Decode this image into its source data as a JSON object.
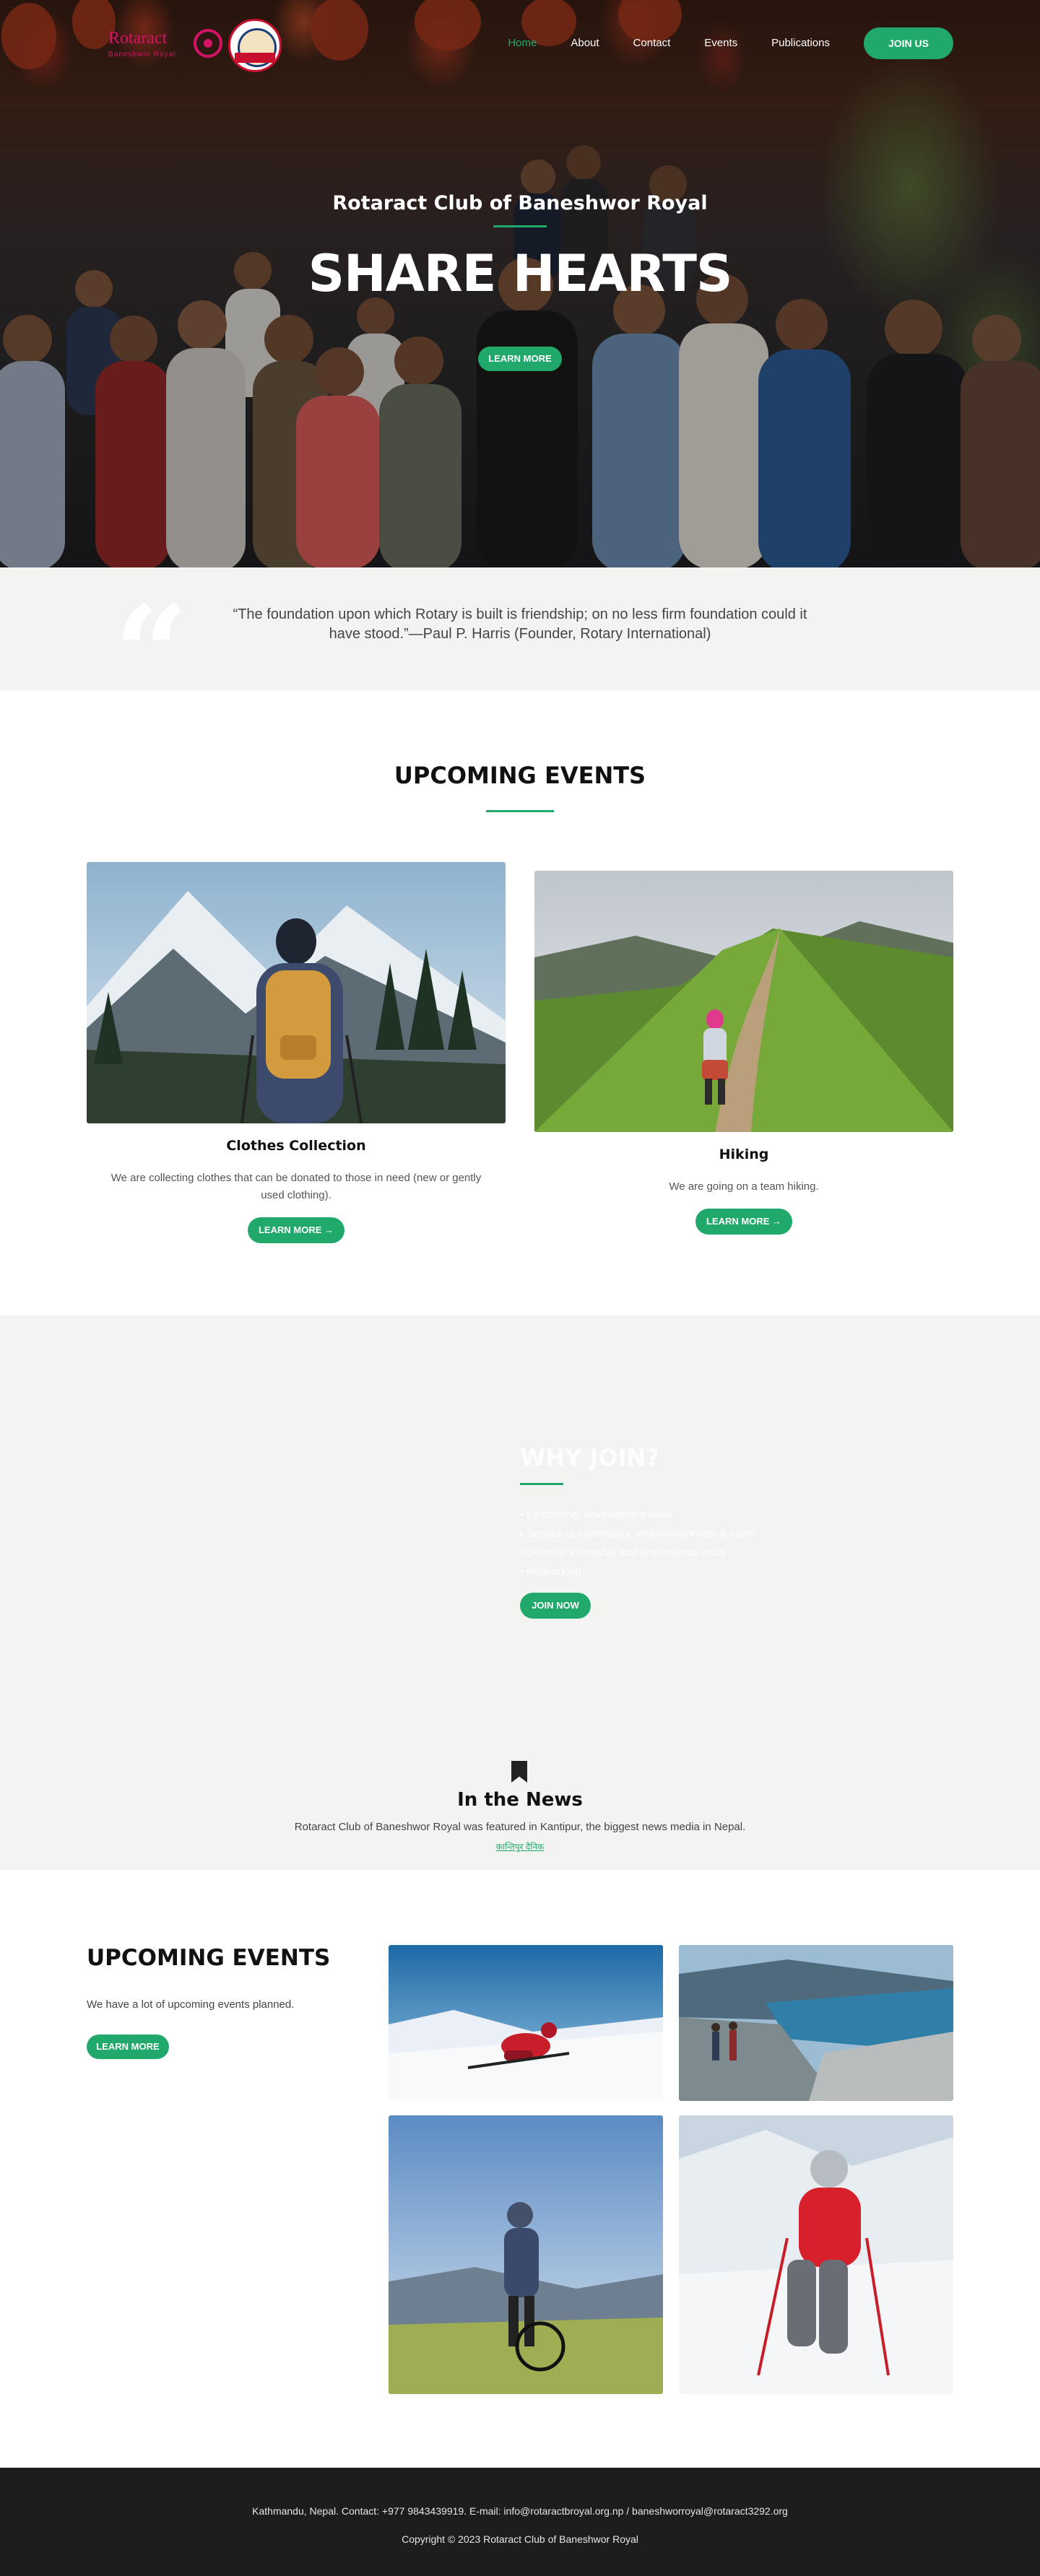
{
  "brand": {
    "logo_text": "Rotaract",
    "logo_sub": "Baneshwor Royal"
  },
  "nav": {
    "items": [
      {
        "label": "Home",
        "active": true
      },
      {
        "label": "About",
        "active": false
      },
      {
        "label": "Contact",
        "active": false
      },
      {
        "label": "Events",
        "active": false
      },
      {
        "label": "Publications",
        "active": false
      }
    ],
    "join_label": "JOIN US"
  },
  "hero": {
    "subtitle": "Rotaract Club of Baneshwor Royal",
    "title": "SHARE HEARTS",
    "button": "LEARN MORE"
  },
  "quote": {
    "icon": "quote-icon",
    "text": "“The foundation upon which Rotary is built is friendship; on no less firm foundation could it have stood.”—Paul P. Harris (Founder, Rotary International)"
  },
  "events": {
    "title": "UPCOMING EVENTS",
    "cards": [
      {
        "title": "Clothes Collection",
        "description": "We are collecting clothes that can be donated to those in need (new or gently used clothing).",
        "button": "LEARN MORE",
        "button_icon": "arrow-right-icon"
      },
      {
        "title": "Hiking",
        "description": "We are going on a team hiking.",
        "button": "LEARN MORE",
        "button_icon": "arrow-right-icon"
      }
    ]
  },
  "why_join": {
    "title": "WHY JOIN?",
    "items": [
      "• Leadership development skills",
      "• Service to community, and environment & more",
      "• Develop friendship and professional skills",
      "• Networking"
    ],
    "button": "JOIN NOW"
  },
  "news": {
    "icon": "bookmark-icon",
    "title": "In the News",
    "text": "Rotaract Club of Baneshwor Royal was featured in Kantipur, the biggest news media in Nepal.",
    "link": "कान्तिपुर दैनिक"
  },
  "upcoming_grid": {
    "title": "UPCOMING EVENTS",
    "text": "We have a lot of upcoming events planned.",
    "button": "LEARN MORE"
  },
  "footer": {
    "contact": "Kathmandu, Nepal. Contact: +977 9843439919. E-mail: info@rotaractbroyal.org.np / baneshworroyal@rotaract3292.org",
    "copyright": "Copyright © 2023 Rotaract Club of Baneshwor Royal"
  },
  "colors": {
    "accent": "#21a96b",
    "brand_pink": "#d41367",
    "footer_bg": "#1d1d1d",
    "section_bg": "#f3f4f2"
  }
}
